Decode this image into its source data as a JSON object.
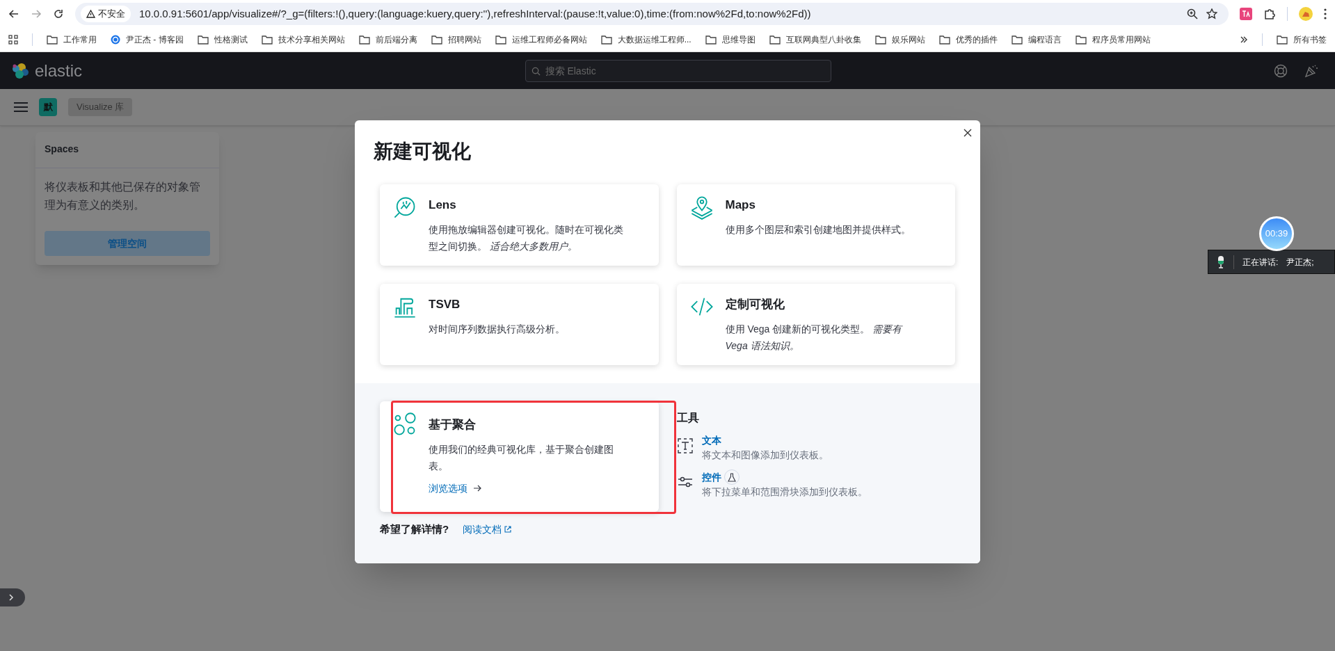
{
  "browser": {
    "security_label": "不安全",
    "url": "10.0.0.91:5601/app/visualize#/?_g=(filters:!(),query:(language:kuery,query:''),refreshInterval:(pause:!t,value:0),time:(from:now%2Fd,to:now%2Fd))",
    "bookmarks": [
      {
        "label": "工作常用",
        "kind": "folder"
      },
      {
        "label": "尹正杰 - 博客园",
        "kind": "site"
      },
      {
        "label": "性格测试",
        "kind": "folder"
      },
      {
        "label": "技术分享相关网站",
        "kind": "folder"
      },
      {
        "label": "前后端分离",
        "kind": "folder"
      },
      {
        "label": "招聘网站",
        "kind": "folder"
      },
      {
        "label": "运维工程师必备网站",
        "kind": "folder"
      },
      {
        "label": "大数据运维工程师...",
        "kind": "folder"
      },
      {
        "label": "思维导图",
        "kind": "folder"
      },
      {
        "label": "互联网典型八卦收集",
        "kind": "folder"
      },
      {
        "label": "娱乐网站",
        "kind": "folder"
      },
      {
        "label": "优秀的插件",
        "kind": "folder"
      },
      {
        "label": "编程语言",
        "kind": "folder"
      },
      {
        "label": "程序员常用网站",
        "kind": "folder"
      }
    ],
    "all_bookmarks": "所有书签"
  },
  "header": {
    "logo_text": "elastic",
    "search": {
      "placeholder": "搜索 Elastic"
    }
  },
  "subheader": {
    "space_badge": "默",
    "breadcrumb": "Visualize 库"
  },
  "spaces_popover": {
    "title": "Spaces",
    "description": "将仪表板和其他已保存的对象管理为有意义的类别。",
    "button": "管理空间"
  },
  "modal": {
    "title": "新建可视化",
    "cards": [
      {
        "kind": "lens",
        "title": "Lens",
        "description": "使用拖放编辑器创建可视化。随时在可视化类型之间切换。 *适合绝大多数用户。*"
      },
      {
        "kind": "maps",
        "title": "Maps",
        "description": "使用多个图层和索引创建地图并提供样式。"
      },
      {
        "kind": "tsvb",
        "title": "TSVB",
        "description": "对时间序列数据执行高级分析。"
      },
      {
        "kind": "code",
        "title": "定制可视化",
        "description": "使用 Vega 创建新的可视化类型。 *需要有 Vega 语法知识。*"
      }
    ],
    "aggregation": {
      "kind": "circles",
      "title": "基于聚合",
      "description": "使用我们的经典可视化库，基于聚合创建图表。",
      "link": "浏览选项"
    },
    "tools": {
      "heading": "工具",
      "items": [
        {
          "kind": "text",
          "title": "文本",
          "description": "将文本和图像添加到仪表板。",
          "experimental": false
        },
        {
          "kind": "controls",
          "title": "控件",
          "description": "将下拉菜单和范围滑块添加到仪表板。",
          "experimental": true
        }
      ]
    },
    "learn_more": {
      "label": "希望了解详情?",
      "link": "阅读文档"
    }
  },
  "recorder": {
    "timer": "00:39",
    "label": "正在讲话:",
    "speaker": "尹正杰;"
  }
}
